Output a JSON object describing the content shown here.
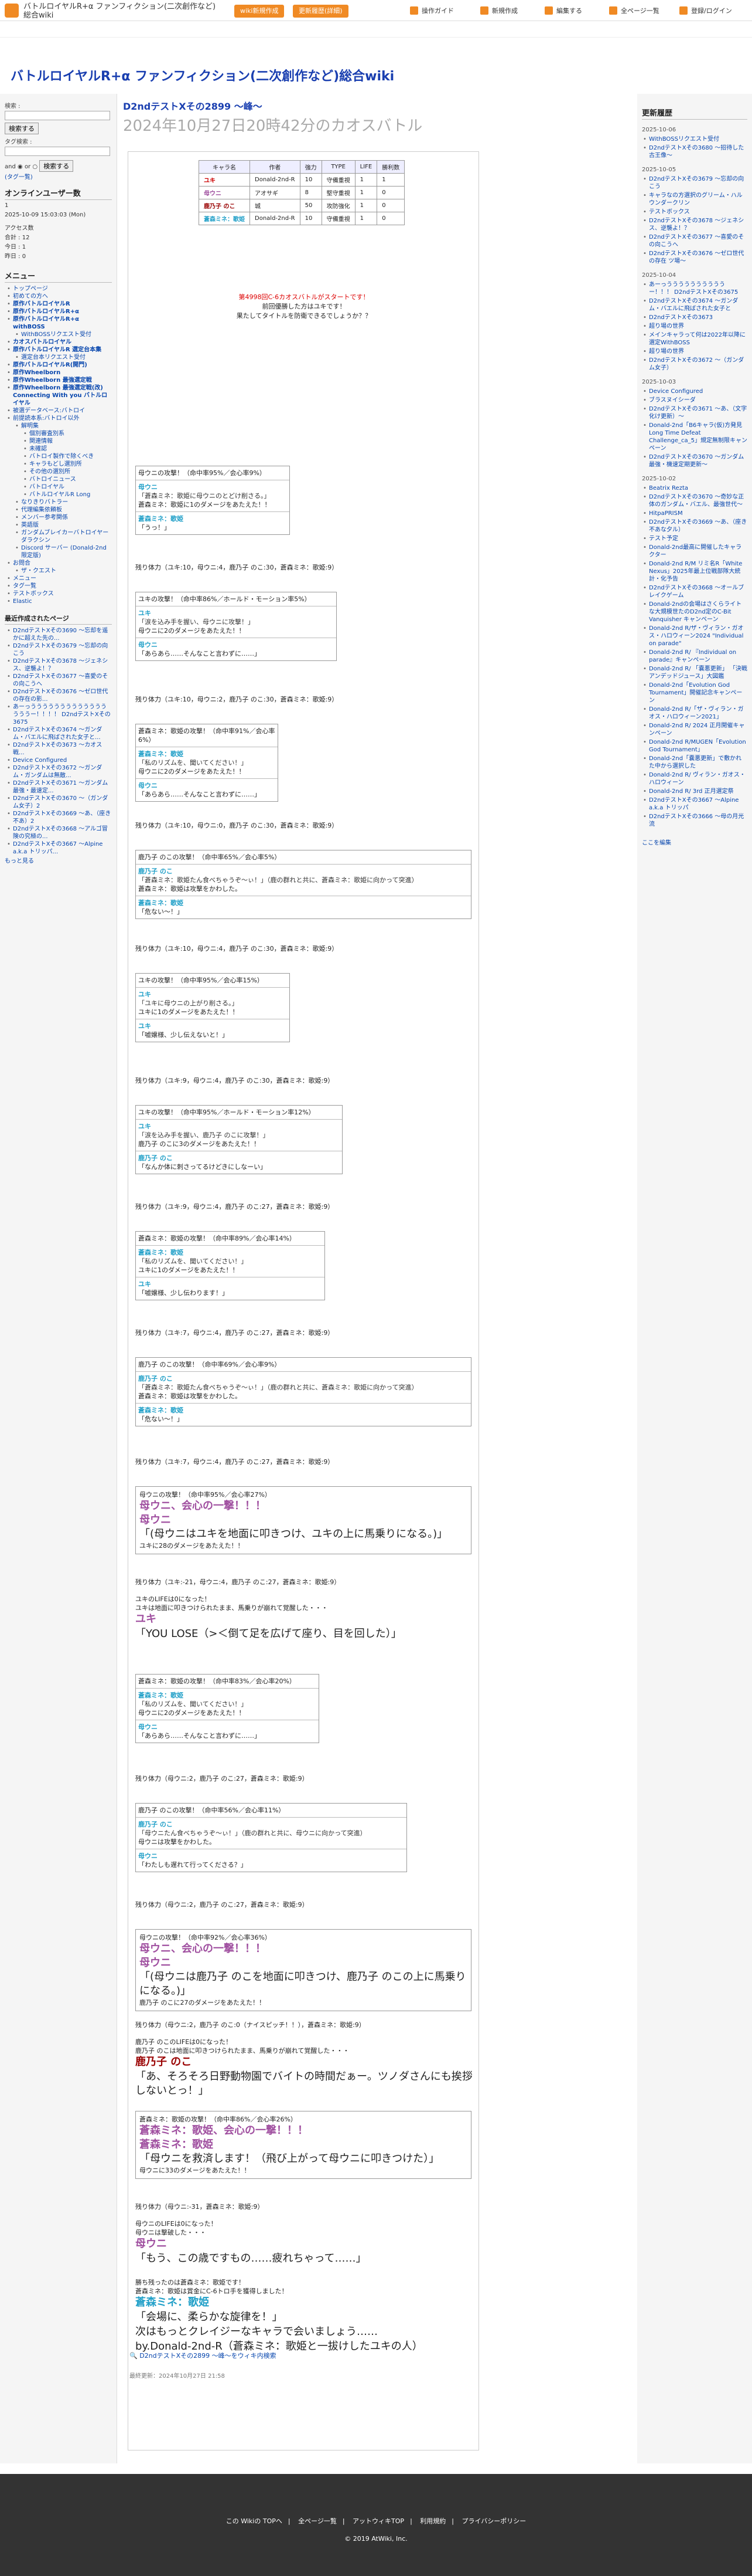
{
  "header": {
    "site_name": "バトルロイヤルR+α ファンフィクション(二次創作など)総合wiki",
    "btn_wiki": "wiki新規作成",
    "btn_edit_history": "更新履歴(詳細)",
    "links": [
      "操作ガイド",
      "新規作成",
      "編集する",
      "全ページ一覧",
      "登録/ログイン"
    ],
    "accent": "#f08a24"
  },
  "site_title": "バトルロイヤルR+α ファンフィクション(二次創作など)総合wiki",
  "left": {
    "search_label": "検索 :",
    "search_button": "検索する",
    "tag_label": "タグ検索 :",
    "radio_and": "and",
    "radio_or": "or",
    "tag_button": "検索する",
    "tag_link": "(タグ一覧)",
    "online_title": "オンラインユーザー数",
    "online_count": "1",
    "date": "2025-10-09 15:03:03 (Mon)",
    "access_title": "アクセス数",
    "access_lines": [
      "合計 : 12",
      "今日 : 1",
      "昨日 : 0"
    ],
    "menu_title": "メニュー",
    "menu_items": [
      {
        "t": "トップページ",
        "lv": 1,
        "b": false
      },
      {
        "t": "初めての方へ",
        "lv": 1,
        "b": false
      },
      {
        "t": "原作バトルロイヤルR",
        "lv": 1,
        "b": true
      },
      {
        "t": "原作バトルロイヤルR+α",
        "lv": 1,
        "b": true
      },
      {
        "t": "原作バトルロイヤルR+α withBOSS",
        "lv": 1,
        "b": true
      },
      {
        "t": "WithBOSSリクエスト受付",
        "lv": 2,
        "b": false
      },
      {
        "t": "カオスバトルロイヤル",
        "lv": 1,
        "b": true
      },
      {
        "t": "原作バトルロイヤルR 選定台本集",
        "lv": 1,
        "b": true
      },
      {
        "t": "選定台本リクエスト受付",
        "lv": 2,
        "b": false
      },
      {
        "t": "原作バトルロイヤルR(開門)",
        "lv": 1,
        "b": true
      },
      {
        "t": "原作Wheelborn",
        "lv": 1,
        "b": true
      },
      {
        "t": "原作Wheelborn 最強選定戦",
        "lv": 1,
        "b": true
      },
      {
        "t": "原作Wheelborn 最強選定戦(改) Connecting With you バトルロイヤル",
        "lv": 1,
        "b": true
      },
      {
        "t": "被選データベース:バトロイ",
        "lv": 1,
        "b": false
      },
      {
        "t": "前提読本系:バトロイ以外",
        "lv": 1,
        "b": false
      },
      {
        "t": "解明集",
        "lv": 2,
        "b": false
      },
      {
        "t": "個別審査別系",
        "lv": 3,
        "b": false
      },
      {
        "t": "関連情報",
        "lv": 3,
        "b": false
      },
      {
        "t": "未確認",
        "lv": 3,
        "b": false
      },
      {
        "t": "バトロイ製作で除くべき",
        "lv": 3,
        "b": false
      },
      {
        "t": "キャラもどし選別所",
        "lv": 3,
        "b": false
      },
      {
        "t": "その他の選別所",
        "lv": 3,
        "b": false
      },
      {
        "t": "バトロイニュース",
        "lv": 3,
        "b": false
      },
      {
        "t": "バトロイヤル",
        "lv": 3,
        "b": false
      },
      {
        "t": "バトルロイヤルR Long",
        "lv": 3,
        "b": false
      },
      {
        "t": "なりきりバトラー",
        "lv": 2,
        "b": false
      },
      {
        "t": "代理編集依頼板",
        "lv": 2,
        "b": false
      },
      {
        "t": "メンバー参考関係",
        "lv": 2,
        "b": false
      },
      {
        "t": "英語版",
        "lv": 2,
        "b": false
      },
      {
        "t": "ガンダムブレイカーバトロイヤーダラクシン",
        "lv": 2,
        "b": false
      },
      {
        "t": "Discord サーバー (Donald-2nd限定版)",
        "lv": 2,
        "b": false
      },
      {
        "t": "お問合",
        "lv": 1,
        "b": false
      },
      {
        "t": "ザ・クエスト",
        "lv": 2,
        "b": false
      },
      {
        "t": "メニュー",
        "lv": 1,
        "b": false
      },
      {
        "t": "タグ一覧",
        "lv": 1,
        "b": false
      },
      {
        "t": "テストボックス",
        "lv": 1,
        "b": false
      },
      {
        "t": "Elastic",
        "lv": 1,
        "b": false
      }
    ],
    "recent_title": "最近作成されたページ",
    "recent_items": [
      "D2ndテストXその3690 ～忘却を遥かに超えた先の...",
      "D2ndテストXその3679 ～忘却の向こう",
      "D2ndテストXその3678 ～ジェネシス、逆襲よ！？",
      "D2ndテストXその3677 ～喜愛のその向こうへ",
      "D2ndテストXその3676 ～ゼロ世代の存在の影...",
      "あーっううううううううううううううううー！！！！ D2ndテストXその3675",
      "D2ndテストXその3674 ～ガンダム・バエルに飛ばされた女子と...",
      "D2ndテストXその3673 ～カオス戦...",
      "Device Configured",
      "D2ndテストXその3672 ～ガンダム・ガンダムは無敵...",
      "D2ndテストXその3671 ～ガンダム最強・最速定...",
      "D2ndテストXその3670 ～（ガンダム女子）2",
      "D2ndテストXその3669 ～あ、（座き不あ）2",
      "D2ndテストXその3668 ～アルゴ冒険の究極の...",
      "D2ndテストXその3667 ～Alpine a.k.a トリッパ..."
    ],
    "more": "もっと見る"
  },
  "main": {
    "title_small": "D2ndテストXその2899 ～峰～",
    "title_large": "2024年10月27日20時42分のカオスバトル",
    "table_headers": [
      "キャラ名",
      "作者",
      "強力",
      "TYPE",
      "LIFE",
      "勝利数"
    ],
    "table_rows": [
      [
        "ユキ",
        "Donald-2nd-R",
        "10",
        "守備重視",
        "1",
        "1"
      ],
      [
        "母ウニ",
        "アオサギ",
        "8",
        "堅守重視",
        "1",
        "0"
      ],
      [
        "鹿乃子 のこ",
        "城",
        "50",
        "攻防強化",
        "1",
        "0"
      ],
      [
        "蒼森ミネ：歌姫",
        "Donald-2nd-R",
        "10",
        "守備重視",
        "1",
        "0"
      ]
    ],
    "intro": [
      "第4998回C-6カオスバトルがスタートです！",
      "前回優勝した方はユキです！",
      "果たしてタイトルを防衛できるでしょうか？？"
    ],
    "close_icon": "×",
    "footer_link": "D2ndテストXその2899 ～峰～をウィキ内検索",
    "last_update": "最終更新：2024年10月27日 21:58"
  },
  "battle": {
    "b1": [
      "母ウニの攻撃！（命中率95%／会心率9%）",
      "母ウニ",
      "「蒼森ミネ：歌姫に母ウニのとどけ削さる。」",
      "蒼森ミネ：歌姫に1のダメージをあたえた！！",
      "蒼森ミネ：歌姫",
      "「うっ！」"
    ],
    "hp1": "残り体力（ユキ:10，母ウニ:4，鹿乃子 のこ:30，蒼森ミネ：歌姫:9）",
    "b2": [
      "ユキの攻撃！（命中率86%／ホールド・モーション率5%）",
      "ユキ",
      "「涙を込み手を握い、母ウニに攻撃！」",
      "母ウニに2のダメージをあたえた！！",
      "母ウニ",
      "「あらあら……そんなこと言わずに……」"
    ],
    "hp2": "残り体力（ユキ:10，母ウニ:2，鹿乃子 のこ:30，蒼森ミネ：歌姫:9）",
    "b3": [
      "蒼森ミネ：歌姫の攻撃！（命中率91%／会心率6%）",
      "蒼森ミネ：歌姫",
      "「私のリズムを、聞いてください！」",
      "母ウニに2のダメージをあたえた！！",
      "母ウニ",
      "「あらあら……そんなこと言わずに……」"
    ],
    "hp3": "残り体力（ユキ:10，母ウニ:0，鹿乃子 のこ:30，蒼森ミネ：歌姫:9）",
    "b4": [
      "鹿乃子 のこの攻撃！（命中率65%／会心率5%）",
      "鹿乃子 のこ",
      "「蒼森ミネ：歌姫たん食べちゃうぞ～ぃ！」（鹿の群れと共に、蒼森ミネ：歌姫に向かって突進）",
      "蒼森ミネ：歌姫は攻撃をかわした。",
      "蒼森ミネ：歌姫",
      "「危ない～！」"
    ],
    "hp4": "残り体力（ユキ:10，母ウニ:4，鹿乃子 のこ:30，蒼森ミネ：歌姫:9）",
    "b5": [
      "ユキの攻撃！（命中率95%／会心率15%）",
      "ユキ",
      "「ユキに母ウニの上がり削さる。」",
      "ユキに1のダメージをあたえた！！",
      "ユキ",
      "「嘘嬢様、少し伝えないと！」"
    ],
    "hp5": "残り体力（ユキ:9，母ウニ:4，鹿乃子 のこ:30，蒼森ミネ：歌姫:9）",
    "b6": [
      "ユキの攻撃！（命中率95%／ホールド・モーション率12%）",
      "ユキ",
      "「涙を込み手を握い、鹿乃子 のこに攻撃！」",
      "鹿乃子 のこに3のダメージをあたえた！！",
      "鹿乃子 のこ",
      "「なんか体に刺さってるけどきにしなーい」"
    ],
    "hp6": "残り体力（ユキ:9，母ウニ:4，鹿乃子 のこ:27，蒼森ミネ：歌姫:9）",
    "b7": [
      "蒼森ミネ：歌姫の攻撃！（命中率89%／会心率14%）",
      "蒼森ミネ：歌姫",
      "「私のリズムを、聞いてください！」",
      "ユキに1のダメージをあたえた！！",
      "ユキ",
      "「嘘嬢様、少し伝わります！」"
    ],
    "hp7": "残り体力（ユキ:7，母ウニ:4，鹿乃子 のこ:27，蒼森ミネ：歌姫:9）",
    "b8": [
      "鹿乃子 のこの攻撃！（命中率69%／会心率9%）",
      "鹿乃子 のこ",
      "「蒼森ミネ：歌姫たん食べちゃうぞ～ぃ！」（鹿の群れと共に、蒼森ミネ：歌姫に向かって突進）",
      "蒼森ミネ：歌姫は攻撃をかわした。",
      "蒼森ミネ：歌姫",
      "「危ない～！」"
    ],
    "hp8": "残り体力（ユキ:7，母ウニ:4，鹿乃子 のこ:27，蒼森ミネ：歌姫:9）",
    "big1": [
      "母ウニの攻撃！（命中率95%／会心率27%）",
      "母ウニ、会心の一撃！！！",
      "母ウニ",
      "「(母ウニはユキを地面に叩きつけ、ユキの上に馬乗りになる。)」",
      "ユキに28のダメージをあたえた！！"
    ],
    "hp9": "残り体力（ユキ:-21，母ウニ:4，鹿乃子 のこ:27，蒼森ミネ：歌姫:9）",
    "ko1": [
      "ユキのLIFEは0になった！",
      "ユキは地面に叩きつけられたまま、馬乗りが崩れて覚醒した・・・"
    ],
    "ko1_name": "ユキ",
    "ko1_line": "「YOU LOSE（>＜倒て足を広げて座り、目を回した）」",
    "b9": [
      "蒼森ミネ：歌姫の攻撃！（命中率83%／会心率20%）",
      "蒼森ミネ：歌姫",
      "「私のリズムを、聞いてください！」",
      "母ウニに2のダメージをあたえた！！",
      "母ウニ",
      "「あらあら……そんなこと言わずに……」"
    ],
    "hp10": "残り体力（母ウニ:2，鹿乃子 のこ:27，蒼森ミネ：歌姫:9）",
    "b10": [
      "鹿乃子 のこの攻撃！（命中率56%／会心率11%）",
      "鹿乃子 のこ",
      "「母ウニたん食べちゃうぞ～ぃ！」（鹿の群れと共に、母ウニに向かって突進）",
      "母ウニは攻撃をかわした。",
      "母ウニ",
      "「わたしも遅れて行ってくださる？」"
    ],
    "hp11": "残り体力（母ウニ:2，鹿乃子 のこ:27，蒼森ミネ：歌姫:9）",
    "big2": [
      "母ウニの攻撃！（命中率92%／会心率36%）",
      "母ウニ、会心の一撃！！！",
      "母ウニ",
      "「(母ウニは鹿乃子 のこを地面に叩きつけ、鹿乃子 のこの上に馬乗りになる。)」",
      "鹿乃子 のこに27のダメージをあたえた！！"
    ],
    "hp12": "残り体力（母ウニ:2，鹿乃子 のこ:0（ナイスピッチ！！），蒼森ミネ：歌姫:9）",
    "ko2": [
      "鹿乃子 のこのLIFEは0になった！",
      "鹿乃子 のこは地面に叩きつけられたまま、馬乗りが崩れて覚醒した・・・"
    ],
    "ko2_name": "鹿乃子 のこ",
    "ko2_line": "「あ、そろそろ日野動物園でバイトの時間だぁー。ツノダさんにも挨拶しないとっ！」",
    "big3": [
      "蒼森ミネ：歌姫の攻撃！（命中率86%／会心率26%）",
      "蒼森ミネ：歌姫、会心の一撃！！！",
      "蒼森ミネ：歌姫",
      "「母ウニを救済します！（飛び上がって母ウニに叩きつけた）」",
      "母ウニに33のダメージをあたえた！！"
    ],
    "hp13": "残り体力（母ウニ:-31，蒼森ミネ：歌姫:9）",
    "ko3": [
      "母ウニのLIFEは0になった！",
      "母ウニは撃破した・・・"
    ],
    "ko3_name": "母ウニ",
    "ko3_line": "「もう、この歳ですもの……疲れちゃって……」",
    "win": [
      "勝ち残ったのは蒼森ミネ：歌姫です！",
      "蒼森ミネ：歌姫は賞金にC-6トロ手を獲得しました！"
    ],
    "win_name": "蒼森ミネ：歌姫",
    "win_line": "「会場に、柔らかな旋律を！」",
    "win_next": "次はもっとクレイジーなキャラで会いましょう……",
    "win_by": "by.Donald-2nd-R（蒼森ミネ：歌姫と一拔けしたユキの人）"
  },
  "right": {
    "title": "更新履歴",
    "groups": [
      {
        "date": "2025-10-06",
        "items": [
          "WithBOSSリクエスト受付",
          "D2ndテストXその3680 ～招待した古王像～"
        ]
      },
      {
        "date": "2025-10-05",
        "items": [
          "D2ndテストXその3679 ～忘却の向こう",
          "キャラなの方選択のグリーム・ハルウンダークリン",
          "テストボックス",
          "D2ndテストXその3678 ～ジェネシス、逆襲よ！？",
          "D2ndテストXその3677 ～喜愛のその向こうへ",
          "D2ndテストXその3676 ～ゼロ世代の存在 ツ場～"
        ]
      },
      {
        "date": "2025-10-04",
        "items": [
          "あーっううううううううううー！！！ D2ndテストXその3675",
          "D2ndテストXその3674 ～ガンダム・バエルに飛ばされた女子と",
          "D2ndテストXその3673",
          "超り場の世界",
          "メインキャラって何は2022年以降に選定WithBOSS",
          "超り場の世界",
          "D2ndテストXその3672 ～（ガンダム女子）"
        ]
      },
      {
        "date": "2025-10-03",
        "items": [
          "Device Configured",
          "ブラスヌイシーダ",
          "D2ndテストXその3671 ～あ、（文字化け更新）～",
          "Donald-2nd「B6キャラ(仮)方発見 Long Time Defeat Challenge_ca_5」規定無制限キャンペーン",
          "D2ndテストXその3670 ～ガンダム最強・機速定期更新～"
        ]
      },
      {
        "date": "2025-10-02",
        "items": [
          "Beatrix Rezta",
          "D2ndテストXその3670 ～奇妙な正体のガンダム・バエル、最強世代～",
          "HitpaPRISM",
          "D2ndテストXその3669 ～あ、（座き不あな夕ル）",
          "テスト予定",
          "Donald-2nd最高に開催したキャラクター",
          "Donald-2nd R/M リミ名R「White Nexus」2025年最上位戦部隊大統計・化予告",
          "D2ndテストXその3668 ～オールブレイクゲーム",
          "Donald-2ndの会場はさくらライトな大規模世たのD2nd定のC-Bit Vanquisher キャンペーン",
          "Donald-2nd R/ザ・ヴィラン・ガオス・ハロウィーン2024 \"Individual on parade\"",
          "Donald-2nd R/ 『Individual on parade』キャンペーン",
          "Donald-2nd R/ 「嚢悪更新」 「決戦アンデッドジュース」大図鑑",
          "Donald-2nd「Evolution God Tournament」開催記念キャンペーン",
          "Donald-2nd R/「ザ・ヴィラン・ガオス・ハロウィーン2021」",
          "Donald-2nd R/ 2024 正月開催キャンペーン",
          "Donald-2nd R/MUGEN「Evolution God Tournament」",
          "Donald-2nd「嚢悪更新」で敷かれた中から選択した",
          "Donald-2nd R/ ヴィラン・ガオス・ハロウィーン",
          "Donald-2nd R/ 3rd 正月選定祭",
          "D2ndテストXその3667 ～Alpine a.k.a トリッパ",
          "D2ndテストXその3666 ～母の月光流"
        ]
      }
    ],
    "edit_link": "ここを編集"
  },
  "footer": {
    "links": [
      "この Wikiの TOPへ",
      "全ページ一覧",
      "アットウィキTOP",
      "利用規約",
      "プライバシーポリシー"
    ],
    "copyright": "2019 AtWiki, Inc."
  }
}
